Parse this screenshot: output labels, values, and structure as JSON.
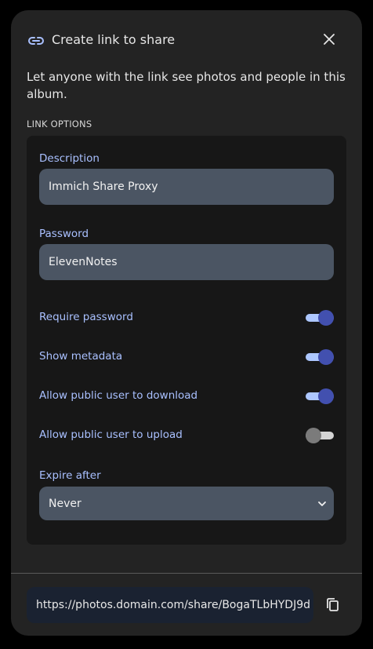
{
  "dialog": {
    "title": "Create link to share",
    "description": "Let anyone with the link see photos and people in this album.",
    "section_label": "LINK OPTIONS"
  },
  "fields": {
    "description_label": "Description",
    "description_value": "Immich Share Proxy",
    "password_label": "Password",
    "password_value": "ElevenNotes"
  },
  "toggles": [
    {
      "label": "Require password",
      "on": true
    },
    {
      "label": "Show metadata",
      "on": true
    },
    {
      "label": "Allow public user to download",
      "on": true
    },
    {
      "label": "Allow public user to upload",
      "on": false
    }
  ],
  "expire": {
    "label": "Expire after",
    "value": "Never"
  },
  "share": {
    "url": "https://photos.domain.com/share/BogaTLbHYDJ9d"
  },
  "colors": {
    "accent": "#4250af",
    "accent_track": "#adc7ff",
    "label": "#a9c0ff"
  },
  "icons": {
    "link": "link-icon",
    "close": "close-icon",
    "chevron": "chevron-down-icon",
    "copy": "copy-icon"
  }
}
